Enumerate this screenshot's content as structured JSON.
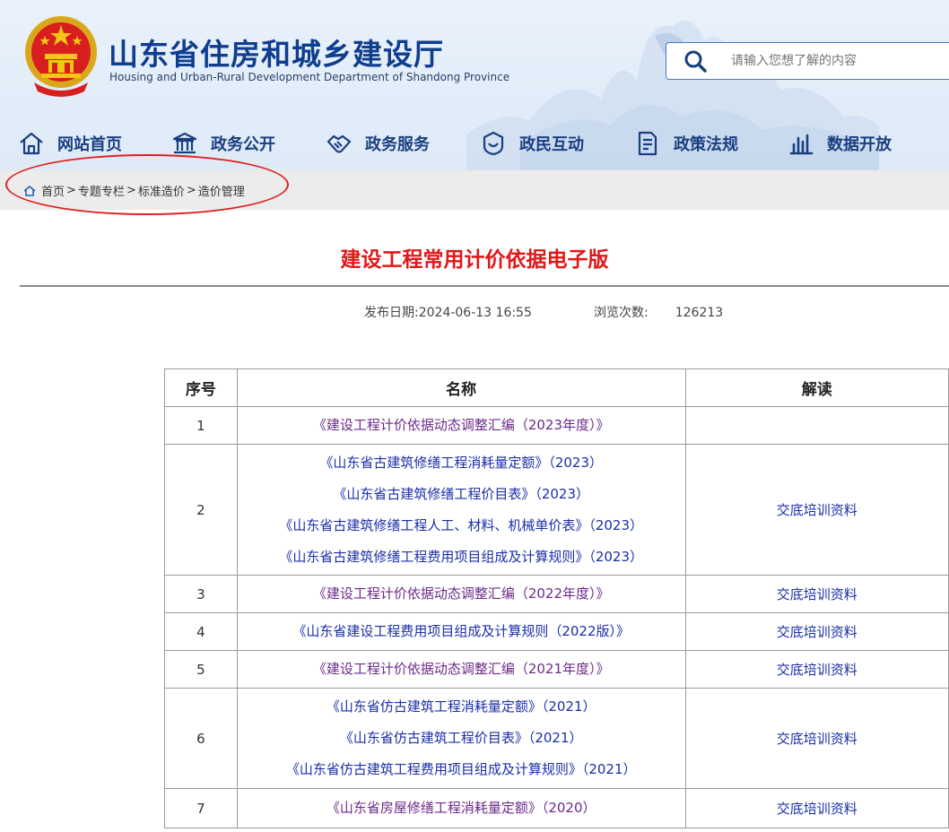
{
  "header": {
    "title": "山东省住房和城乡建设厅",
    "subtitle": "Housing and Urban-Rural Development Department of Shandong Province",
    "search_placeholder": "请输入您想了解的内容"
  },
  "nav": [
    {
      "label": "网站首页",
      "icon": "home-icon"
    },
    {
      "label": "政务公开",
      "icon": "government-building-icon"
    },
    {
      "label": "政务服务",
      "icon": "handshake-icon"
    },
    {
      "label": "政民互动",
      "icon": "interaction-icon"
    },
    {
      "label": "政策法规",
      "icon": "document-icon"
    },
    {
      "label": "数据开放",
      "icon": "bar-chart-icon"
    }
  ],
  "breadcrumb": [
    "首页",
    "专题专栏",
    "标准造价",
    "造价管理"
  ],
  "breadcrumb_sep": ">",
  "article": {
    "title": "建设工程常用计价依据电子版",
    "publish_label": "发布日期:",
    "publish_date": "2024-06-13 16:55",
    "views_label": "浏览次数:",
    "views": "126213"
  },
  "table": {
    "headers": [
      "序号",
      "名称",
      "解读"
    ],
    "rows": [
      {
        "no": "1",
        "names": [
          "《建设工程计价依据动态调整汇编（2023年度）》"
        ],
        "reading": ""
      },
      {
        "no": "2",
        "names": [
          "《山东省古建筑修缮工程消耗量定额》（2023）",
          "《山东省古建筑修缮工程价目表》（2023）",
          "《山东省古建筑修缮工程人工、材料、机械单价表》（2023）",
          "《山东省古建筑修缮工程费用项目组成及计算规则》（2023）"
        ],
        "reading": "交底培训资料"
      },
      {
        "no": "3",
        "names": [
          "《建设工程计价依据动态调整汇编（2022年度）》"
        ],
        "reading": "交底培训资料"
      },
      {
        "no": "4",
        "names": [
          "《山东省建设工程费用项目组成及计算规则（2022版）》"
        ],
        "reading": "交底培训资料"
      },
      {
        "no": "5",
        "names": [
          "《建设工程计价依据动态调整汇编（2021年度）》"
        ],
        "reading": "交底培训资料"
      },
      {
        "no": "6",
        "names": [
          "《山东省仿古建筑工程消耗量定额》（2021）",
          "《山东省仿古建筑工程价目表》（2021）",
          "《山东省仿古建筑工程费用项目组成及计算规则》（2021）"
        ],
        "reading": "交底培训资料"
      },
      {
        "no": "7",
        "names": [
          "《山东省房屋修缮工程消耗量定额》（2020）"
        ],
        "reading": "交底培训资料"
      }
    ]
  },
  "colors": {
    "title_red": "#e01818",
    "nav_blue": "#1a3f80",
    "link_blue": "#1a2fa8",
    "visited_purple": "#6b2a8a",
    "highlight_red": "#e02020"
  }
}
